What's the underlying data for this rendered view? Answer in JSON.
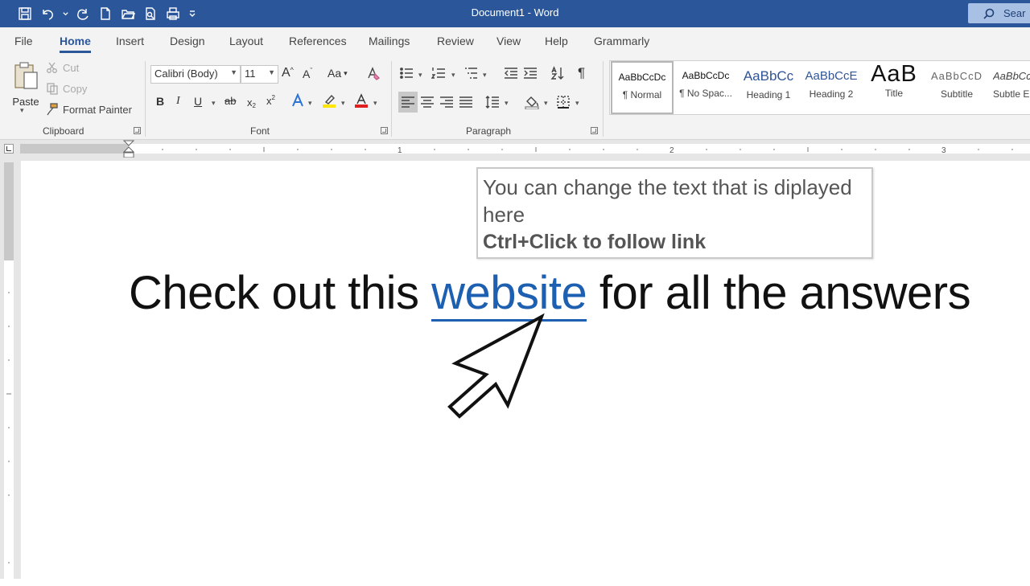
{
  "app": {
    "title": "Document1  -  Word",
    "search_placeholder": "Sear"
  },
  "tabs": [
    "File",
    "Home",
    "Insert",
    "Design",
    "Layout",
    "References",
    "Mailings",
    "Review",
    "View",
    "Help",
    "Grammarly"
  ],
  "clipboard": {
    "paste": "Paste",
    "cut": "Cut",
    "copy": "Copy",
    "format_painter": "Format Painter",
    "label": "Clipboard"
  },
  "font": {
    "name": "Calibri (Body)",
    "size": "11",
    "label": "Font",
    "bold": "B",
    "italic": "I",
    "underline": "U",
    "strike": "ab",
    "subscript": "x",
    "superscript": "x",
    "grow": "A",
    "shrink": "A",
    "case": "Aa"
  },
  "paragraph": {
    "label": "Paragraph"
  },
  "styles": [
    {
      "preview": "AaBbCcDc",
      "name": "¶ Normal"
    },
    {
      "preview": "AaBbCcDc",
      "name": "¶ No Spac..."
    },
    {
      "preview": "AaBbCc",
      "name": "Heading 1"
    },
    {
      "preview": "AaBbCcE",
      "name": "Heading 2"
    },
    {
      "preview": "AaB",
      "name": "Title"
    },
    {
      "preview": "AaBbCcD",
      "name": "Subtitle"
    },
    {
      "preview": "AaBbCc",
      "name": "Subtle E"
    }
  ],
  "ruler": {
    "marks": [
      "1",
      "2",
      "3"
    ]
  },
  "document": {
    "before": "Check out this ",
    "link": "website",
    "after": " for all the answers"
  },
  "tooltip": {
    "line1": "You can change the text that is diplayed here",
    "line2": "Ctrl+Click to follow link"
  },
  "colors": {
    "titlebar": "#2b579a",
    "link": "#1d5fb0",
    "highlight": "#ffe600",
    "font_color": "#e02020"
  }
}
